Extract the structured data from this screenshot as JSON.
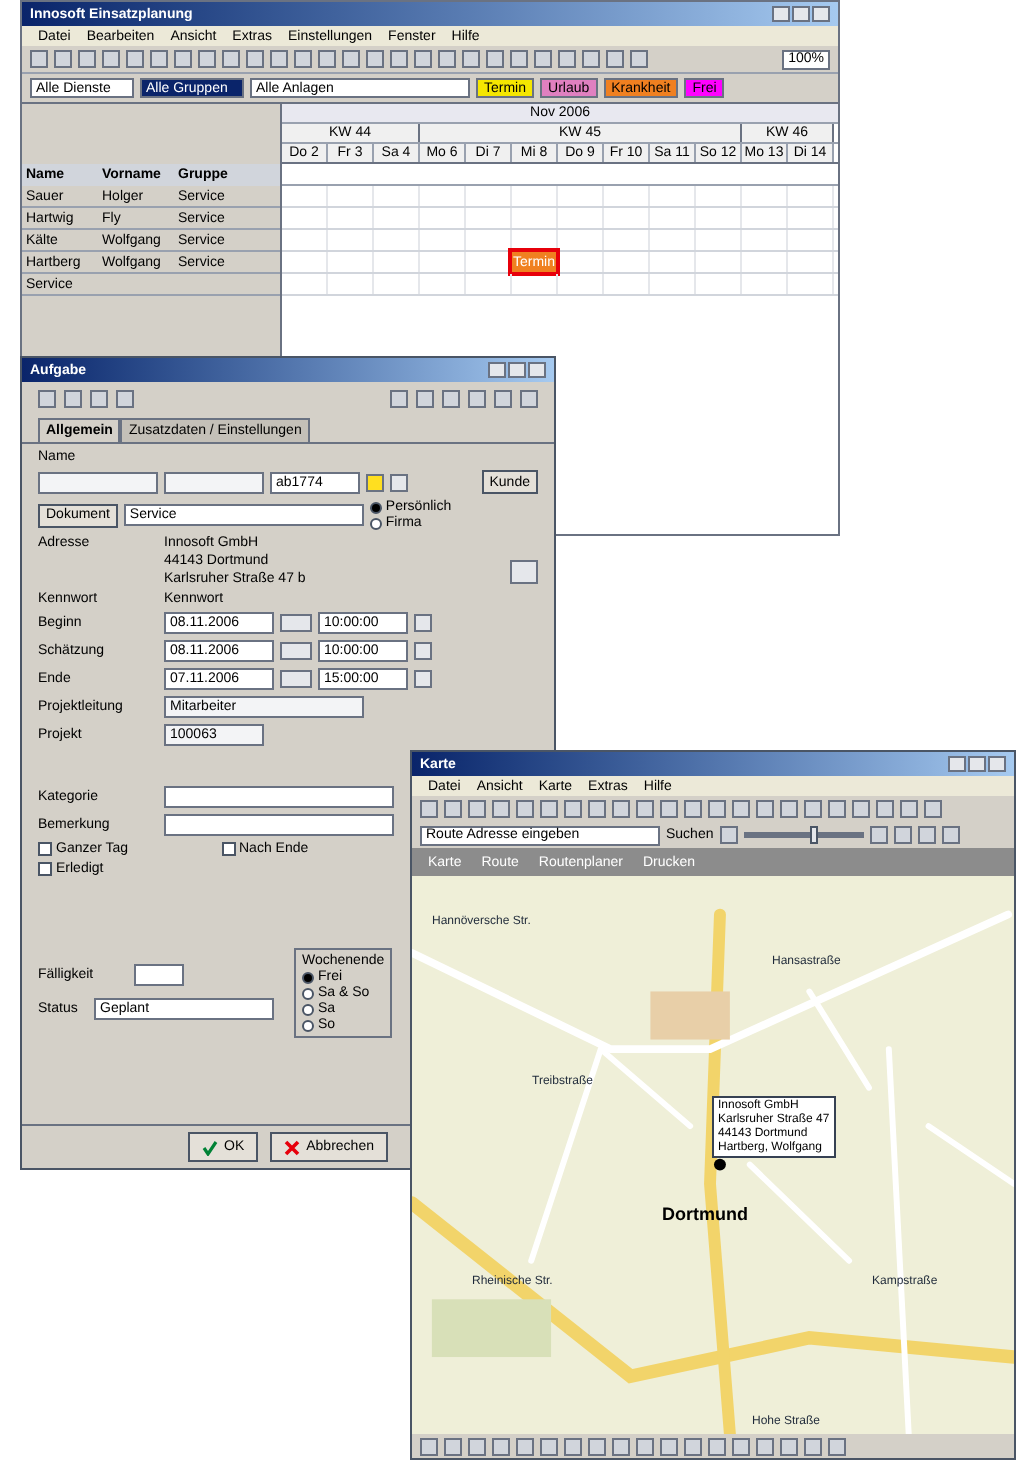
{
  "planner": {
    "title": "Innosoft Einsatzplanung",
    "menu": [
      "Datei",
      "Bearbeiten",
      "Ansicht",
      "Extras",
      "Einstellungen",
      "Fenster",
      "Hilfe"
    ],
    "filters": [
      {
        "value": "Alle Dienste",
        "selected": false
      },
      {
        "value": "Alle Gruppen",
        "selected": true
      },
      {
        "value": "Alle Anlagen",
        "selected": false
      }
    ],
    "zoom": "100%",
    "legend": [
      {
        "label": "Termin",
        "color": "#f5e600"
      },
      {
        "label": "Urlaub",
        "color": "#e080c0"
      },
      {
        "label": "Krankheit",
        "color": "#f08020"
      },
      {
        "label": "Frei",
        "color": "#ff00ff"
      }
    ],
    "month": "Nov 2006",
    "weeks": [
      {
        "label": "KW 44",
        "days": [
          "Do 2",
          "Fr 3",
          "Sa 4"
        ]
      },
      {
        "label": "KW 45",
        "days": [
          "Mo 6",
          "Di 7",
          "Mi 8",
          "Do 9",
          "Fr 10",
          "Sa 11",
          "So 12"
        ]
      },
      {
        "label": "KW 46",
        "days": [
          "Mo 13",
          "Di 14"
        ]
      }
    ],
    "columns": [
      "Name",
      "Vorname",
      "Gruppe"
    ],
    "rows": [
      {
        "cells": [
          "Sauer",
          "Holger",
          "Service"
        ]
      },
      {
        "cells": [
          "Hartwig",
          "Fly",
          "Service"
        ]
      },
      {
        "cells": [
          "Kälte",
          "Wolfgang",
          "Service"
        ]
      },
      {
        "cells": [
          "Hartberg",
          "Wolfgang",
          "Service"
        ],
        "appointment": "Termin"
      },
      {
        "cells": [
          "Service"
        ]
      }
    ]
  },
  "dialog": {
    "title": "Aufgabe",
    "tabs": [
      {
        "label": "Allgemein",
        "selected": true
      },
      {
        "label": "Zusatzdaten / Einstellungen",
        "selected": false
      }
    ],
    "name_label": "Name",
    "number": "ab1774",
    "service": "Service",
    "customer_button": "Kunde",
    "kunde_button": "Dokument",
    "radios": [
      {
        "label": "Persönlich",
        "selected": true
      },
      {
        "label": "Firma",
        "selected": false
      }
    ],
    "customer_label": "Adresse",
    "customer": [
      "Innosoft GmbH",
      "44143 Dortmund",
      "Karlsruher Straße 47 b"
    ],
    "kennwort_label": "Kennwort",
    "kennwort": "Kennwort",
    "times": [
      {
        "label": "Beginn",
        "date": "08.11.2006",
        "time": "10:00:00"
      },
      {
        "label": "Schätzung",
        "date": "08.11.2006",
        "time": "10:00:00"
      },
      {
        "label": "Ende",
        "date": "07.11.2006",
        "time": "15:00:00"
      }
    ],
    "projektleitung_label": "Projektleitung",
    "projektleitung": "Mitarbeiter",
    "projekt_label": "Projekt",
    "projekt": "100063",
    "kategorie_label": "Kategorie",
    "bemerkung_label": "Bemerkung",
    "checks": [
      {
        "label": "Ganzer Tag",
        "checked": false
      },
      {
        "label": "Nach Ende",
        "checked": false
      },
      {
        "label": "Erledigt",
        "checked": false
      }
    ],
    "faelligkeit_label": "Fälligkeit",
    "status_label": "Status",
    "status": "Geplant",
    "wochenende_label": "Wochenende",
    "weekend": [
      {
        "label": "Frei",
        "selected": true
      },
      {
        "label": "Sa & So",
        "selected": false
      },
      {
        "label": "Sa",
        "selected": false
      },
      {
        "label": "So",
        "selected": false
      }
    ],
    "buttons": [
      {
        "label": "OK",
        "kind": "ok"
      },
      {
        "label": "Abbrechen",
        "kind": "cancel"
      }
    ]
  },
  "map": {
    "title": "Karte",
    "menu": [
      "Datei",
      "Ansicht",
      "Karte",
      "Extras",
      "Hilfe"
    ],
    "route_field": "Route Adresse eingeben",
    "search_label": "Suchen",
    "zoom_slider": {
      "level": 0.6
    },
    "tabs": [
      "Karte",
      "Route",
      "Routenplaner",
      "Drucken"
    ],
    "city": "Dortmund",
    "popup": [
      "Innosoft GmbH",
      "Karlsruher Straße 47",
      "44143 Dortmund",
      "Hartberg, Wolfgang"
    ],
    "streets": [
      "Hannöversche Str.",
      "Treibstraße",
      "Rheinische Str.",
      "Hansastraße",
      "Kampstraße",
      "Hohe Straße"
    ]
  }
}
